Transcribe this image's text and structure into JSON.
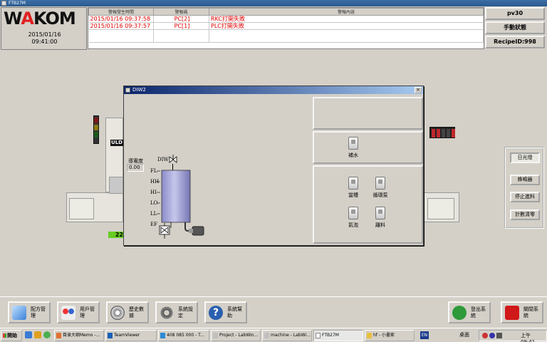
{
  "window": {
    "title": "FTB27M"
  },
  "header": {
    "logo": "WAKOM",
    "date": "2015/01/16",
    "time": "09:41:00",
    "alarm_table": {
      "columns": [
        "警報發生時間",
        "警報碼",
        "警報內容"
      ],
      "rows": [
        {
          "time": "2015/01/16 09:37:58",
          "code": "PC[2]",
          "content": "RKC打開失敗"
        },
        {
          "time": "2015/01/16 09:37:57",
          "code": "PC[1]",
          "content": "PLC打開失敗"
        }
      ]
    },
    "right_buttons": [
      "pv30",
      "手動狀態",
      "RecipeID:998"
    ]
  },
  "workspace": {
    "uld_label": "ULD",
    "green_value": "22",
    "control_panel": {
      "buttons": [
        "日光燈",
        "蜂鳴器",
        "停止進料",
        "計數清零"
      ]
    }
  },
  "dialog": {
    "title": "DIW2",
    "conductivity_label": "導電度",
    "conductivity_value": "0.00",
    "valve_label": "DIW",
    "levels": [
      "FL",
      "HH",
      "HI",
      "LO",
      "LL",
      "EF"
    ],
    "switches": [
      "補水",
      "當槽",
      "循環泵",
      "氣泡",
      "離料"
    ]
  },
  "toolbar": {
    "buttons": [
      {
        "label": "配方管理",
        "icon": "recipe-icon"
      },
      {
        "label": "用戶管理",
        "icon": "users-icon"
      },
      {
        "label": "歷史數據",
        "icon": "history-icon"
      },
      {
        "label": "系統設定",
        "icon": "settings-icon"
      },
      {
        "label": "系統幫助",
        "icon": "help-icon"
      },
      {
        "label": "登出系統",
        "icon": "logout-icon"
      },
      {
        "label": "關閉系統",
        "icon": "power-icon"
      }
    ]
  },
  "taskbar": {
    "start": "開始",
    "tasks": [
      "目录大纲Memo -...",
      "TeamViewer",
      "408 085 000 - T...",
      "Project - LabWin...",
      "machine - LabWi...",
      "FTB27M",
      "hf - 小畫家"
    ],
    "lang": "EN",
    "desktop": "桌面",
    "clock": "上午 09:41"
  }
}
